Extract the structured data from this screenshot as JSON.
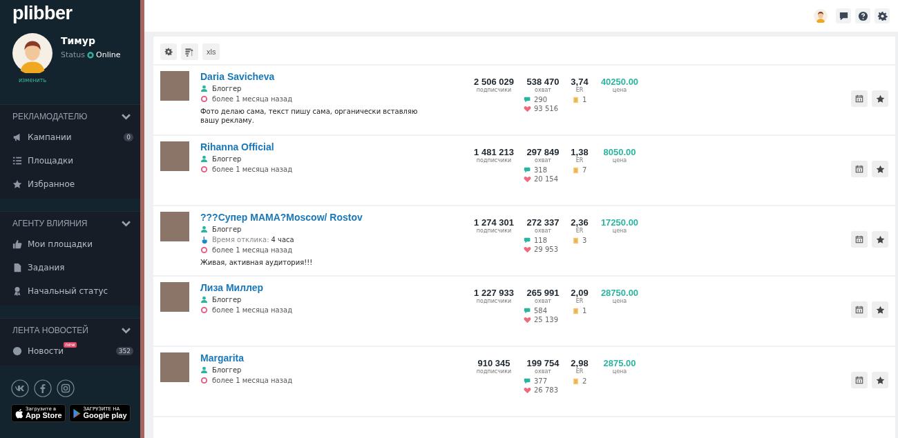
{
  "sidebar": {
    "logo": "plibber",
    "user": {
      "name": "Тимур",
      "status_label": "Status",
      "status": "Online",
      "change_link": "изменить"
    },
    "sections": [
      {
        "title": "РЕКЛАМОДАТЕЛЮ",
        "items": [
          {
            "label": "Кампании",
            "badge": "0"
          },
          {
            "label": "Площадки"
          },
          {
            "label": "Избранное"
          }
        ]
      },
      {
        "title": "АГЕНТУ ВЛИЯНИЯ",
        "items": [
          {
            "label": "Мои площадки"
          },
          {
            "label": "Задания"
          },
          {
            "label": "Начальный статус"
          }
        ]
      },
      {
        "title": "ЛЕНТА НОВОСТЕЙ",
        "items": [
          {
            "label": "Новости",
            "tag": "new",
            "badge": "352"
          }
        ]
      }
    ],
    "stores": [
      {
        "small": "Загрузите в",
        "big": "App Store"
      },
      {
        "small": "ЗАГРУЗИТЕ НА",
        "big": "Google play"
      }
    ]
  },
  "toolbar": {
    "export_label": "xls"
  },
  "rows": [
    {
      "name": "Daria Savicheva",
      "role": "Блоггер",
      "last_seen": "более 1 месяца назад",
      "description": "Фото делаю сама, текст пишу сама, органически вставляю вашу рекламу.",
      "stats": [
        {
          "value": "2 506 029",
          "label": "подписчики"
        },
        {
          "value": "538 470",
          "label": "охват"
        },
        {
          "value": "3,74",
          "label": "ER"
        },
        {
          "value": "40250.00",
          "label": "цена"
        }
      ],
      "comments": "290",
      "likes": "93 516",
      "posts": "1"
    },
    {
      "name": "Rihanna Official",
      "role": "Блоггер",
      "last_seen": "более 1 месяца назад",
      "stats": [
        {
          "value": "1 481 213",
          "label": "подписчики"
        },
        {
          "value": "297 849",
          "label": "охват"
        },
        {
          "value": "1,38",
          "label": "ER"
        },
        {
          "value": "8050.00",
          "label": "цена"
        }
      ],
      "comments": "318",
      "likes": "20 154",
      "posts": "7"
    },
    {
      "name": "???Супер МАМА?Moscow/ Rostov",
      "role": "Блоггер",
      "response_label": "Время отклика:",
      "response_value": "4 часа",
      "last_seen": "более 1 месяца назад",
      "description": "Живая, активная аудитория!!!",
      "stats": [
        {
          "value": "1 274 301",
          "label": "подписчики"
        },
        {
          "value": "272 337",
          "label": "охват"
        },
        {
          "value": "2,36",
          "label": "ER"
        },
        {
          "value": "17250.00",
          "label": "цена"
        }
      ],
      "comments": "118",
      "likes": "29 953",
      "posts": "3"
    },
    {
      "name": "Лиза Миллер",
      "role": "Блоггер",
      "last_seen": "более 1 месяца назад",
      "stats": [
        {
          "value": "1 227 933",
          "label": "подписчики"
        },
        {
          "value": "265 991",
          "label": "охват"
        },
        {
          "value": "2,09",
          "label": "ER"
        },
        {
          "value": "28750.00",
          "label": "цена"
        }
      ],
      "comments": "584",
      "likes": "25 139",
      "posts": "1"
    },
    {
      "name": "Margarita",
      "role": "Блоггер",
      "last_seen": "более 1 месяца назад",
      "stats": [
        {
          "value": "910 345",
          "label": "подписчики"
        },
        {
          "value": "199 754",
          "label": "охват"
        },
        {
          "value": "2,98",
          "label": "ER"
        },
        {
          "value": "2875.00",
          "label": "цена"
        }
      ],
      "comments": "377",
      "likes": "26 783",
      "posts": "2"
    }
  ]
}
